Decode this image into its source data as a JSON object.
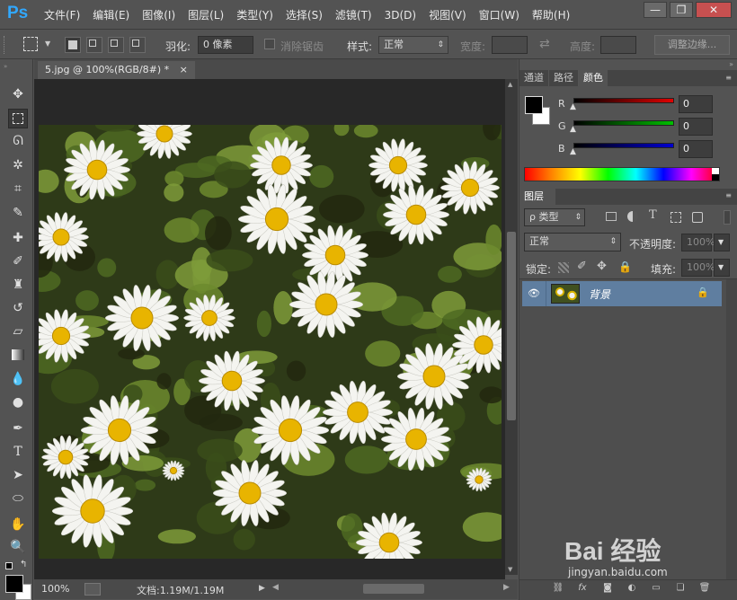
{
  "app": {
    "logo": "Ps"
  },
  "menu": [
    "文件(F)",
    "编辑(E)",
    "图像(I)",
    "图层(L)",
    "类型(Y)",
    "选择(S)",
    "滤镜(T)",
    "3D(D)",
    "视图(V)",
    "窗口(W)",
    "帮助(H)"
  ],
  "window_controls": {
    "minimize": "—",
    "restore": "❐",
    "close": "✕"
  },
  "options": {
    "feather_label": "羽化:",
    "feather_value": "0 像素",
    "antialias_label": "消除锯齿",
    "style_label": "样式:",
    "style_value": "正常",
    "width_label": "宽度:",
    "height_label": "高度:",
    "refine_edge_label": "调整边缘..."
  },
  "document": {
    "tab_title": "5.jpg @ 100%(RGB/8#) *",
    "tab_close": "×"
  },
  "status": {
    "zoom": "100%",
    "doc_info": "文档:1.19M/1.19M"
  },
  "color_panel": {
    "tabs": [
      "通道",
      "路径",
      "颜色"
    ],
    "active_tab": "颜色",
    "channels": [
      {
        "label": "R",
        "value": "0",
        "color": "#e00000"
      },
      {
        "label": "G",
        "value": "0",
        "color": "#00c000"
      },
      {
        "label": "B",
        "value": "0",
        "color": "#0000d0"
      }
    ]
  },
  "layers_panel": {
    "tab": "图层",
    "filter_label": "ρ 类型",
    "blend_mode": "正常",
    "opacity_label": "不透明度:",
    "opacity_value": "100%",
    "lock_label": "锁定:",
    "fill_label": "填充:",
    "fill_value": "100%",
    "layers": [
      {
        "name": "背景",
        "visible": true,
        "locked": true
      }
    ]
  },
  "watermark": {
    "brand": "Bai 经验",
    "url": "jingyan.baidu.com"
  },
  "colors": {
    "accent": "#31a8ff",
    "layer_selected": "#5f7ea0",
    "canvas_bg": "#282828"
  }
}
